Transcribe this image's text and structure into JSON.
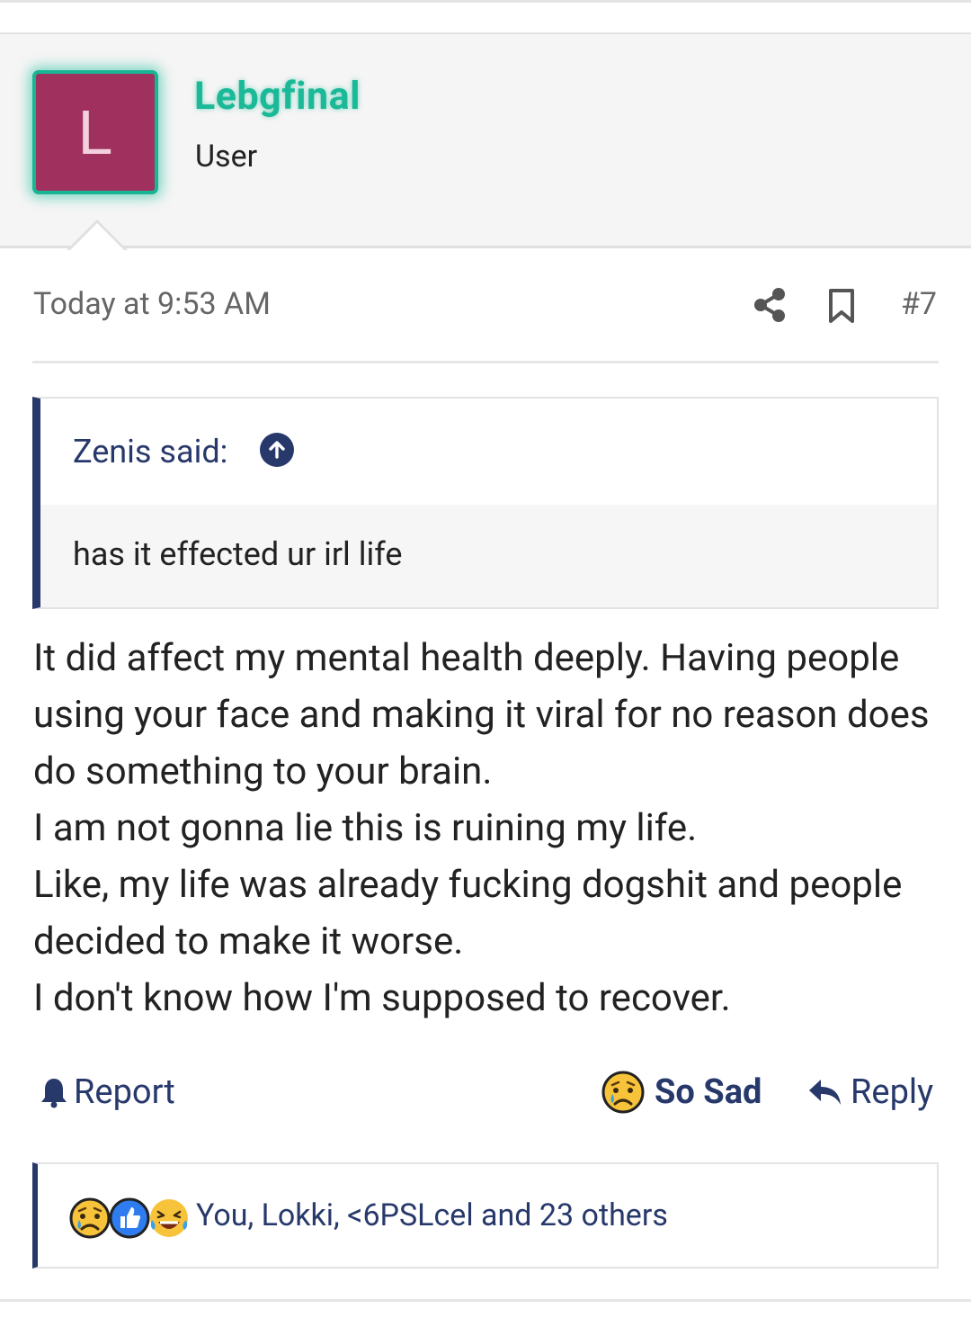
{
  "colors": {
    "accent": "#27386b",
    "username": "#1bb998",
    "avatar_bg": "#a0315f"
  },
  "user": {
    "avatar_letter": "L",
    "name": "Lebgfinal",
    "title": "User"
  },
  "post": {
    "date": "Today at 9:53 AM",
    "number": "#7",
    "icons": [
      "share-icon",
      "bookmark-icon"
    ]
  },
  "quote": {
    "author": "Zenis said:",
    "text": "has it effected ur irl life"
  },
  "message": {
    "lines": [
      "It did affect my mental health deeply. Having people using your face and making it viral for no reason does do something to your brain.",
      "I am not gonna lie this is ruining my life.",
      "Like, my life was already fucking dogshit and people decided to make it worse.",
      "I don't know how I'm supposed to recover."
    ]
  },
  "actions": {
    "report": "Report",
    "reaction": "So Sad",
    "reply": "Reply"
  },
  "reactions": {
    "icons": [
      "so-sad-icon",
      "like-icon",
      "laugh-icon"
    ],
    "summary": "You, Lokki, <6PSLcel and 23 others"
  }
}
